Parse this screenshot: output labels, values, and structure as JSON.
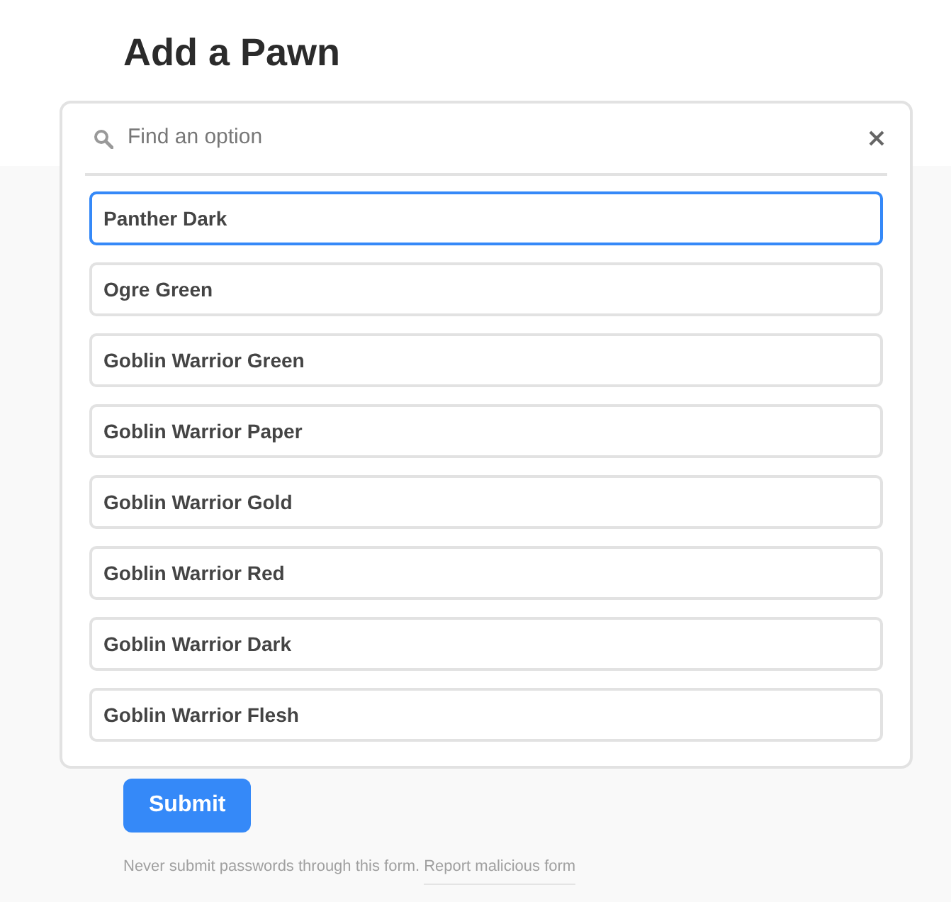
{
  "title": "Add a Pawn",
  "dropdown": {
    "search": {
      "placeholder": "Find an option"
    },
    "options": [
      {
        "label": "Panther Dark",
        "selected": true
      },
      {
        "label": "Ogre Green",
        "selected": false
      },
      {
        "label": "Goblin Warrior Green",
        "selected": false
      },
      {
        "label": "Goblin Warrior Paper",
        "selected": false
      },
      {
        "label": "Goblin Warrior Gold",
        "selected": false
      },
      {
        "label": "Goblin Warrior Red",
        "selected": false
      },
      {
        "label": "Goblin Warrior Dark",
        "selected": false
      },
      {
        "label": "Goblin Warrior Flesh",
        "selected": false
      }
    ]
  },
  "submit": "Submit",
  "footer": {
    "note": "Never submit passwords through this form.",
    "link": "Report malicious form"
  }
}
